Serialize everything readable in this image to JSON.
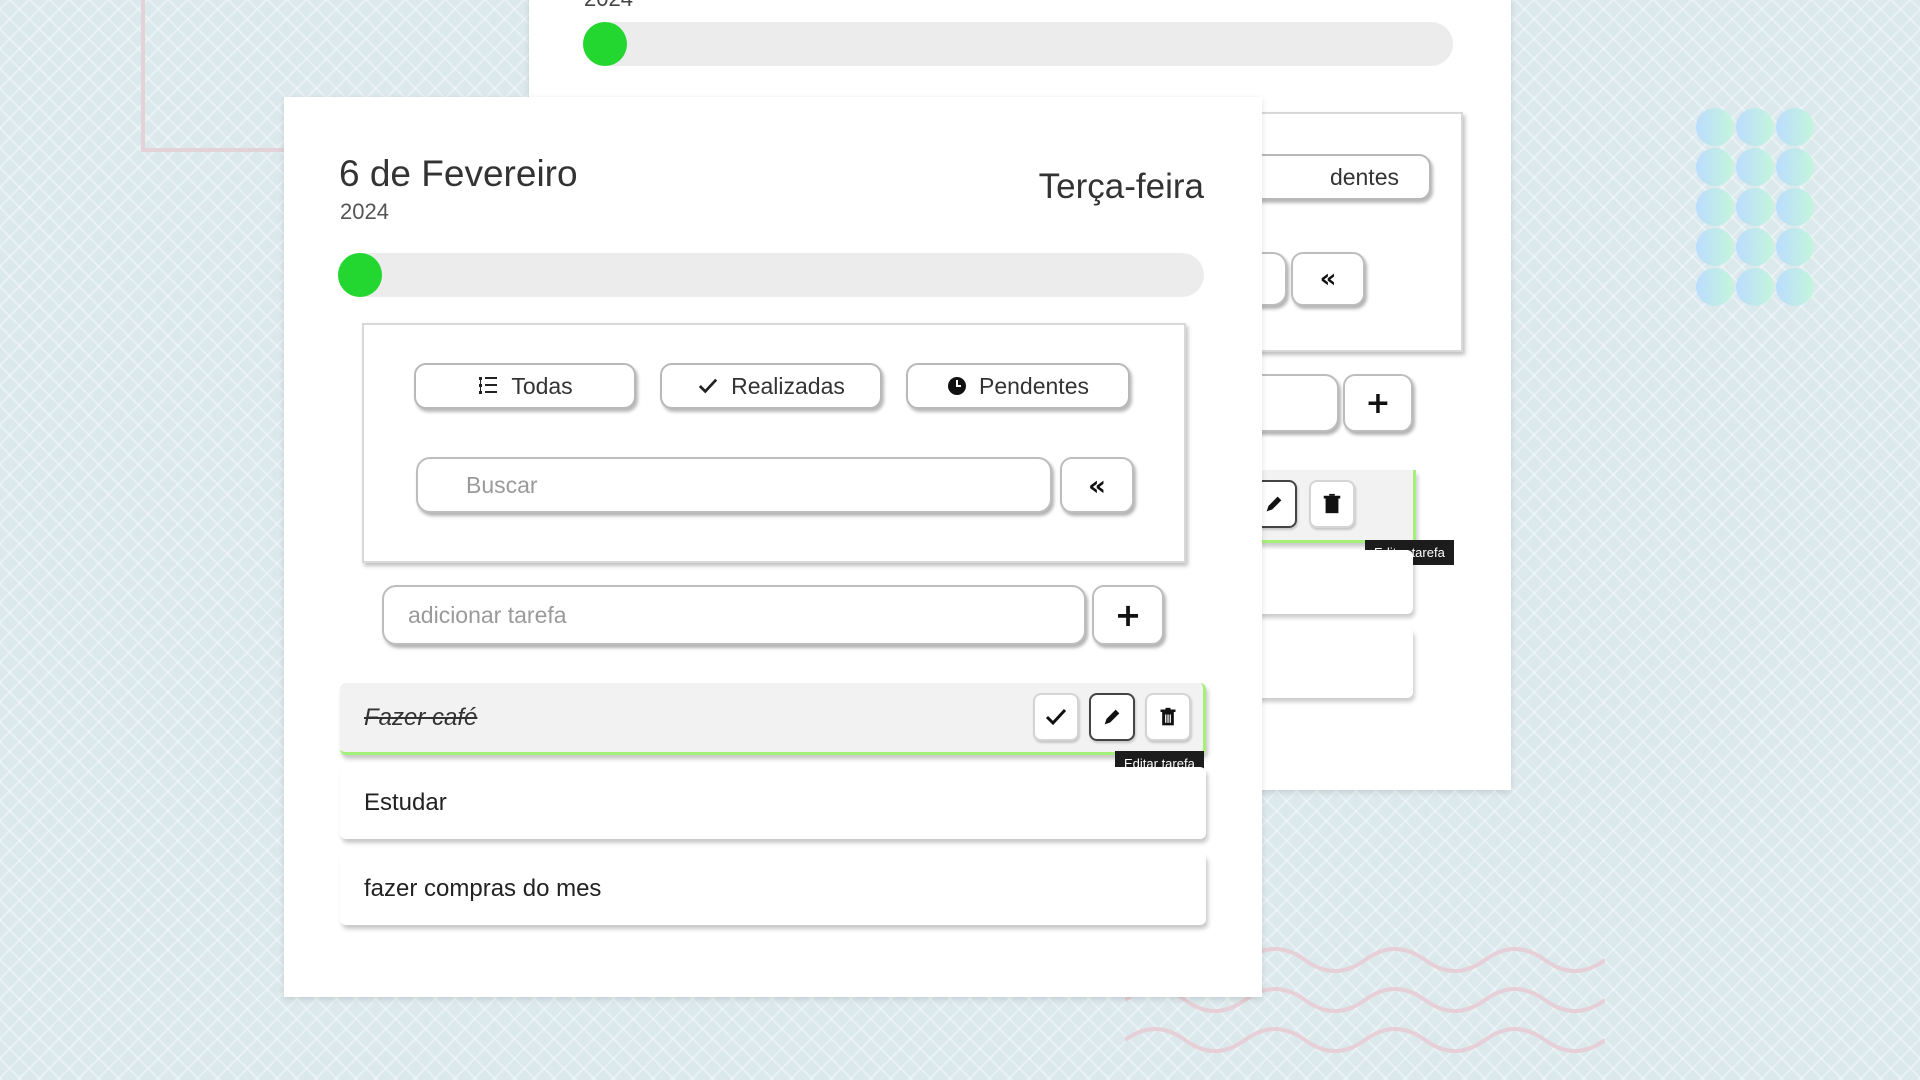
{
  "background_card": {
    "year": "2024",
    "filters_partial": {
      "pending_label_fragment": "dentes"
    },
    "collapse_icon": "«",
    "add_icon": "+",
    "tooltip": "Editar tarefa",
    "progress": 0
  },
  "main_card": {
    "date": "6 de Fevereiro",
    "year": "2024",
    "weekday": "Terça-feira",
    "progress": 0,
    "accent_color": "#24d630",
    "filters": [
      {
        "label": "Todas",
        "icon": "list-icon"
      },
      {
        "label": "Realizadas",
        "icon": "check-icon"
      },
      {
        "label": "Pendentes",
        "icon": "clock-icon"
      }
    ],
    "search": {
      "placeholder": "Buscar",
      "value": ""
    },
    "collapse_icon": "«",
    "add_task": {
      "placeholder": "adicionar tarefa",
      "value": ""
    },
    "add_icon": "+",
    "tasks": [
      {
        "label": "Fazer café",
        "done": true
      },
      {
        "label": "Estudar",
        "done": false
      },
      {
        "label": "fazer compras do mes",
        "done": false
      }
    ],
    "task_actions": [
      "check-icon",
      "pencil-icon",
      "trash-icon"
    ],
    "tooltip": "Editar tarefa"
  }
}
